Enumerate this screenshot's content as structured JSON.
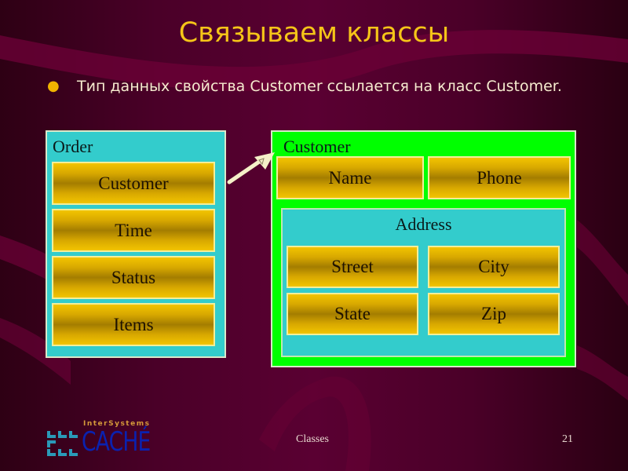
{
  "slide": {
    "title": "Связываем классы",
    "bullet": "Тип данных свойства Customer ссылается на класс Customer.",
    "footer_center": "Classes",
    "page_number": "21"
  },
  "logo": {
    "brand_small": "InterSystems",
    "brand_big": "CACHÉ",
    "icon": "intersystems-logo-icon"
  },
  "diagram": {
    "order": {
      "label": "Order",
      "properties": [
        "Customer",
        "Time",
        "Status",
        "Items"
      ]
    },
    "customer": {
      "label": "Customer",
      "properties": [
        "Name",
        "Phone"
      ],
      "address": {
        "label": "Address",
        "properties": [
          "Street",
          "City",
          "State",
          "Zip"
        ]
      }
    },
    "relation": {
      "from": "Order.Customer",
      "to": "Customer",
      "icon": "reference-arrow-icon"
    }
  },
  "colors": {
    "title": "#f5c518",
    "class_box": "#33cccc",
    "referenced_class_box": "#00ff00",
    "property_fill": "#d8a800",
    "background": "#4a0028"
  }
}
